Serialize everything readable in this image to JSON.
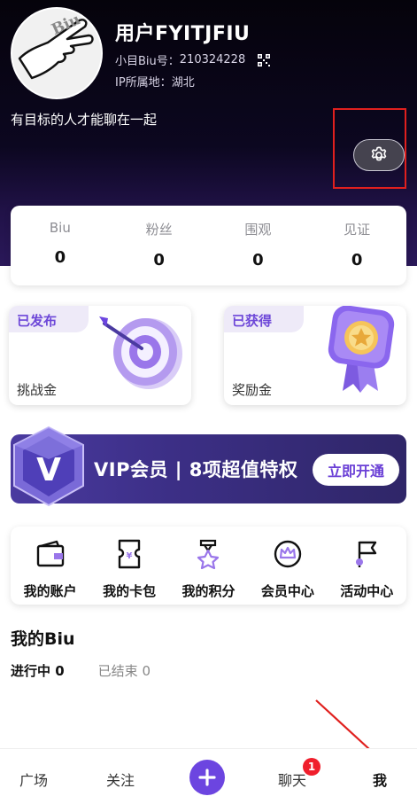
{
  "profile": {
    "username": "用户FYITJFIU",
    "biu_id_label": "小目Biu号：",
    "biu_id": "210324228",
    "ip_label": "IP所属地：",
    "ip_location": "湖北",
    "bio": "有目标的人才能聊在一起",
    "avatar_text": "Biu"
  },
  "stats": [
    {
      "label": "Biu",
      "value": "0"
    },
    {
      "label": "粉丝",
      "value": "0"
    },
    {
      "label": "围观",
      "value": "0"
    },
    {
      "label": "见证",
      "value": "0"
    }
  ],
  "features": {
    "left": {
      "title": "已发布",
      "subtitle": "挑战金",
      "icon": "target-icon"
    },
    "right": {
      "title": "已获得",
      "subtitle": "奖励金",
      "icon": "medal-icon"
    }
  },
  "vip": {
    "text": "VIP会员 | 8项超值特权",
    "button": "立即开通",
    "gem_letter": "V"
  },
  "menu": [
    {
      "label": "我的账户",
      "icon": "wallet-icon"
    },
    {
      "label": "我的卡包",
      "icon": "card-pack-icon"
    },
    {
      "label": "我的积分",
      "icon": "points-icon"
    },
    {
      "label": "会员中心",
      "icon": "crown-icon"
    },
    {
      "label": "活动中心",
      "icon": "flag-icon"
    }
  ],
  "my_biu": {
    "title": "我的Biu",
    "tabs": [
      {
        "label": "进行中 0",
        "active": true
      },
      {
        "label": "已结束 0",
        "active": false
      }
    ]
  },
  "nav": {
    "square": "广场",
    "follow": "关注",
    "chat": "聊天",
    "me": "我",
    "chat_badge": "1"
  },
  "colors": {
    "accent": "#6c45e0",
    "badge": "#f01e2c",
    "highlight": "#e0201e"
  }
}
